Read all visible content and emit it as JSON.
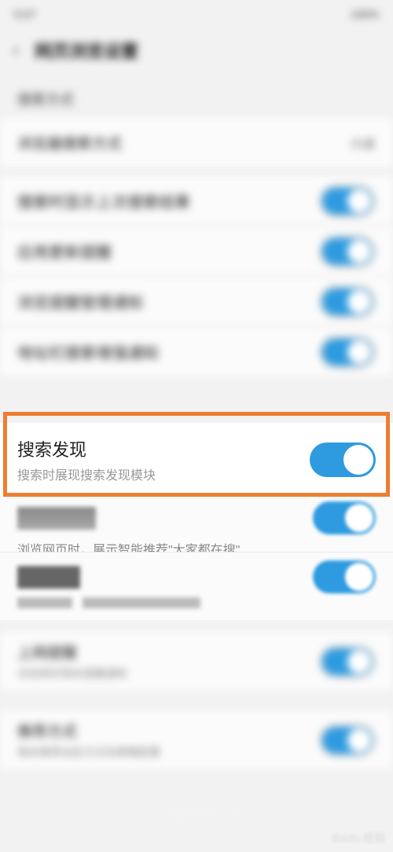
{
  "status_bar": {
    "left": "5:47",
    "right": "100%"
  },
  "header": {
    "back": "‹",
    "title": "网页浏览设置"
  },
  "section1": {
    "label": "搜索方式"
  },
  "row1": {
    "label": "浏览器搜索方式",
    "value": "内置"
  },
  "toggles_block": [
    {
      "label": "搜索时显示上次搜索结果"
    },
    {
      "label": "应用更新提醒"
    },
    {
      "label": "浏览提醒管理通知"
    },
    {
      "label": "地址栏搜索增强通知"
    }
  ],
  "highlight": {
    "title": "搜索发现",
    "subtitle": "搜索时展现搜索发现模块"
  },
  "row_640": {
    "title": "大家都在搜",
    "subtitle": "浏览网页时，展示智能推荐\"大家都在搜\""
  },
  "row_700": {
    "title": "页面推荐",
    "subtitle": "浏览网页时展示页面内容推荐"
  },
  "bottom_rows": [
    {
      "title": "上网提醒",
      "sub": "浏览网页相关提醒通知"
    },
    {
      "title": "推荐方式",
      "sub": "相关推荐设定方式及策略配置"
    }
  ],
  "watermark": "Baidu 经验"
}
